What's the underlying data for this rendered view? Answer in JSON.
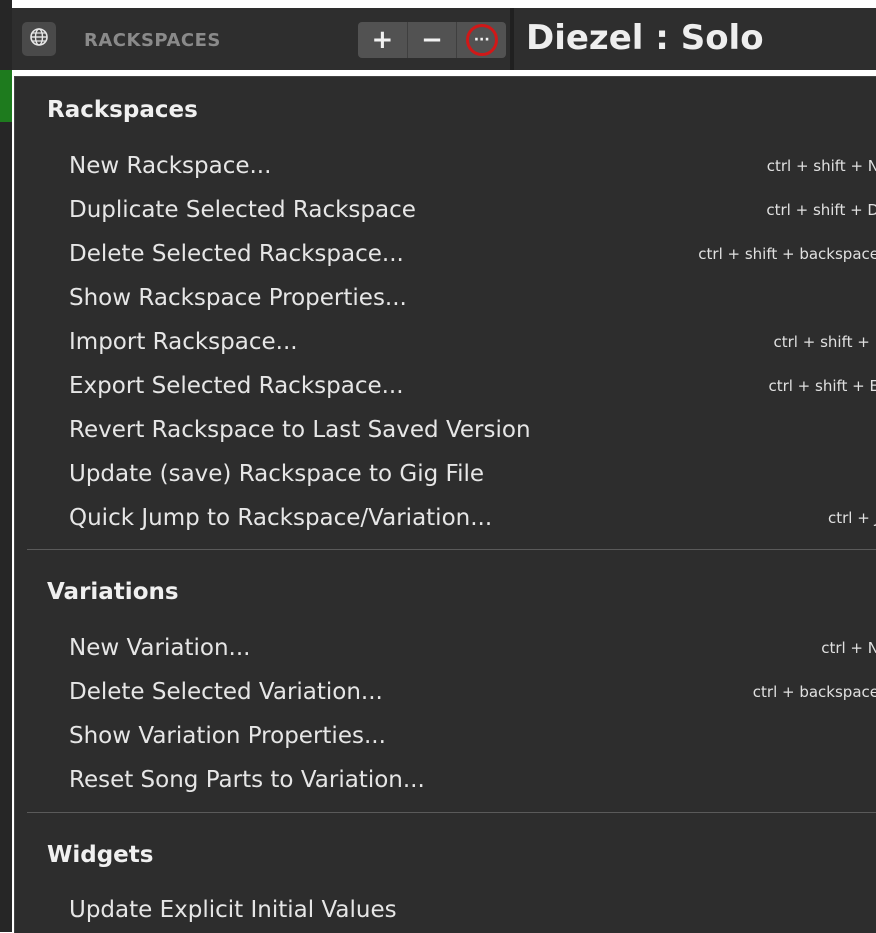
{
  "header": {
    "section_label": "RACKSPACES",
    "add_label": "+",
    "remove_label": "−",
    "more_label": "···",
    "rackspace_title": "Diezel : Solo"
  },
  "menu": {
    "sections": [
      {
        "title": "Rackspaces",
        "items": [
          {
            "label": "New Rackspace...",
            "shortcut": "ctrl + shift + N"
          },
          {
            "label": "Duplicate Selected Rackspace",
            "shortcut": "ctrl + shift + D"
          },
          {
            "label": "Delete Selected Rackspace...",
            "shortcut": "ctrl + shift + backspace"
          },
          {
            "label": "Show Rackspace Properties...",
            "shortcut": ""
          },
          {
            "label": "Import Rackspace...",
            "shortcut": "ctrl + shift + I"
          },
          {
            "label": "Export Selected Rackspace...",
            "shortcut": "ctrl + shift + E"
          },
          {
            "label": "Revert Rackspace to Last Saved Version",
            "shortcut": ""
          },
          {
            "label": "Update (save) Rackspace to Gig File",
            "shortcut": ""
          },
          {
            "label": "Quick Jump to Rackspace/Variation...",
            "shortcut": "ctrl + J"
          }
        ]
      },
      {
        "title": "Variations",
        "items": [
          {
            "label": "New Variation...",
            "shortcut": "ctrl + N"
          },
          {
            "label": "Delete Selected Variation...",
            "shortcut": "ctrl + backspace"
          },
          {
            "label": "Show Variation Properties...",
            "shortcut": ""
          },
          {
            "label": "Reset Song Parts to Variation...",
            "shortcut": ""
          }
        ]
      },
      {
        "title": "Widgets",
        "items": [
          {
            "label": "Update Explicit Initial Values",
            "shortcut": ""
          }
        ]
      }
    ]
  },
  "colors": {
    "menu_bg": "#2d2d2d",
    "topbar_bg": "#2e2e2e",
    "highlight_ring": "#d01818",
    "accent_green": "#1e7b1e"
  },
  "icons": {
    "globe": "globe-icon",
    "add": "plus-icon",
    "remove": "minus-icon",
    "more": "more-options-icon"
  }
}
